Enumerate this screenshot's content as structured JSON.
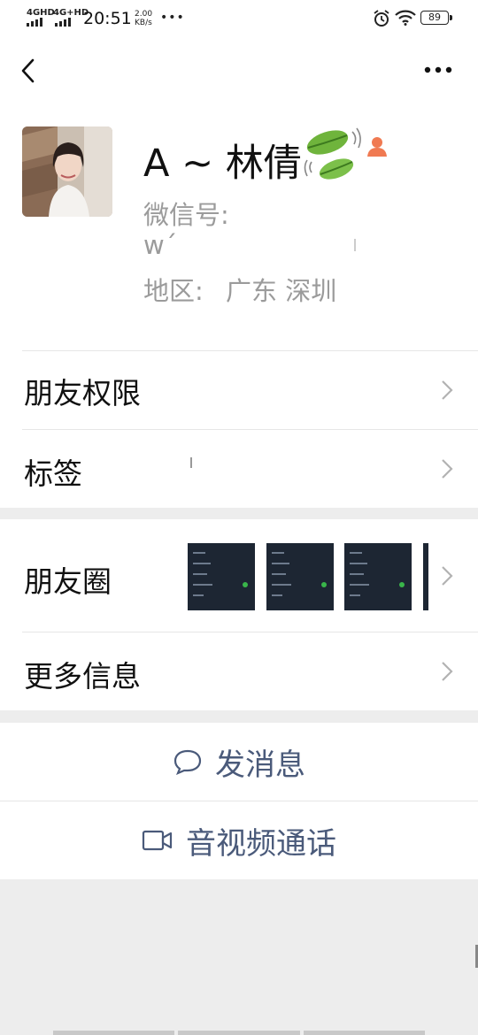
{
  "status_bar": {
    "network_1": "4GHD",
    "network_2": "4G+HD",
    "time": "20:51",
    "speed_value": "2.00",
    "speed_unit": "KB/s",
    "more": "•••",
    "battery": "89"
  },
  "profile": {
    "name": "A ~ 林倩",
    "wechat_id_label": "微信号:",
    "wechat_id_value": "w´",
    "region_label": "地区:",
    "region_value": "广东  深圳"
  },
  "menu": {
    "friend_permissions": "朋友权限",
    "tags": "标签",
    "moments": "朋友圈",
    "more_info": "更多信息"
  },
  "actions": {
    "send_message": "发消息",
    "video_call": "音视频通话"
  },
  "colors": {
    "action_text": "#4a5a7a",
    "separator_bg": "#ededed"
  }
}
